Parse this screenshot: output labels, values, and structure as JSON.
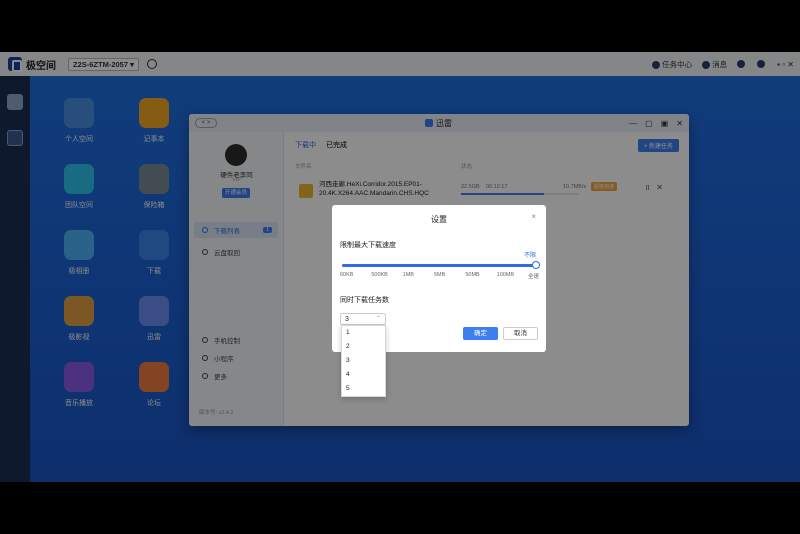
{
  "system_bar": {
    "brand": "极空间",
    "device": "Z2S-6ZTM-2057",
    "task_center": "任务中心",
    "messages": "消息"
  },
  "desktop_icons": [
    {
      "label": "个人空间",
      "color": "#4a90e2"
    },
    {
      "label": "记事本",
      "color": "#f5a623"
    },
    {
      "label": "团队空间",
      "color": "#2ec4f0"
    },
    {
      "label": "保险箱",
      "color": "#7d8a99"
    },
    {
      "label": "极相册",
      "color": "#4fb3f6"
    },
    {
      "label": "下载",
      "color": "#3a86e8"
    },
    {
      "label": "极影视",
      "color": "#e0a040"
    },
    {
      "label": "迅雷",
      "color": "#6a8cf0"
    },
    {
      "label": "音乐播放",
      "color": "#8a5ce6"
    },
    {
      "label": "论坛",
      "color": "#f07b3f"
    }
  ],
  "window": {
    "title": "迅雷",
    "nav": "< >",
    "user_name": "硬件老李同",
    "user_sub": "VIP",
    "vip_button": "开通会员",
    "sidebar": {
      "download_list": "下载列表",
      "download_count": "1",
      "cloud_add": "云盘取回",
      "phone_control": "手机控制",
      "mini_program": "小程序",
      "more": "更多",
      "version": "版本号: v2.4.2"
    },
    "tabs": {
      "downloading": "下载中",
      "completed": "已完成"
    },
    "new_task": "+ 新建任务",
    "columns": {
      "filename": "文件名",
      "status": "状态"
    },
    "task": {
      "name": "河西走廊.HeXi.Corridor.2015.EP01-20.4K.X264.AAC.Mandarin.CHS.HQC",
      "size": "22.5GB",
      "time": "00:12:17",
      "speed": "10.7MB/s",
      "accel": "超级加速",
      "progress": 0.7
    }
  },
  "dialog": {
    "title": "设置",
    "close": "×",
    "speed_label": "限制最大下载速度",
    "unlimited": "不限",
    "ticks": [
      "60KB",
      "500KB",
      "1MB",
      "5MB",
      "50MB",
      "100MB",
      "全速"
    ],
    "slider_value": 1.0,
    "tasks_label": "同时下载任务数",
    "tasks_selected": "3",
    "ok": "确定",
    "cancel": "取消",
    "options": [
      "1",
      "2",
      "3",
      "4",
      "5"
    ]
  }
}
